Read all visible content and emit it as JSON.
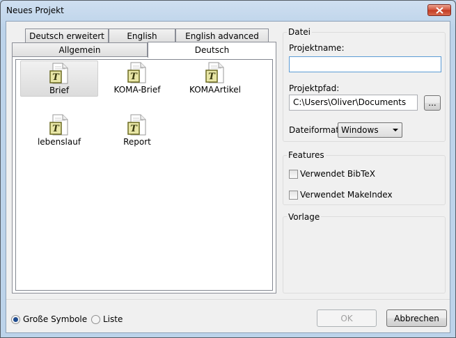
{
  "window": {
    "title": "Neues Projekt"
  },
  "tabs": {
    "row_back": [
      "Deutsch erweitert",
      "English",
      "English advanced"
    ],
    "row_front": [
      "Allgemein",
      "Deutsch"
    ],
    "active": "Deutsch"
  },
  "templates": [
    {
      "label": "Brief",
      "selected": true,
      "icon": "tex-document-icon"
    },
    {
      "label": "KOMA-Brief",
      "selected": false,
      "icon": "tex-document-icon"
    },
    {
      "label": "KOMAArtikel",
      "selected": false,
      "icon": "tex-document-icon"
    },
    {
      "label": "lebenslauf",
      "selected": false,
      "icon": "tex-document-icon"
    },
    {
      "label": "Report",
      "selected": false,
      "icon": "tex-document-icon"
    }
  ],
  "datei": {
    "group_title": "Datei",
    "projektname_label": "Projektname:",
    "projektname_value": "",
    "projektpfad_label": "Projektpfad:",
    "projektpfad_value": "C:\\Users\\Oliver\\Documents",
    "browse_label": "...",
    "dateiformat_label": "Dateiformat:",
    "dateiformat_value": "Windows"
  },
  "features": {
    "group_title": "Features",
    "bibtex_label": "Verwendet BibTeX",
    "bibtex_checked": false,
    "makeindex_label": "Verwendet MakeIndex",
    "makeindex_checked": false
  },
  "vorlage": {
    "group_title": "Vorlage"
  },
  "view": {
    "large_icons_label": "Große Symbole",
    "list_label": "Liste",
    "selected": "large_icons"
  },
  "buttons": {
    "ok": "OK",
    "cancel": "Abbrechen"
  }
}
